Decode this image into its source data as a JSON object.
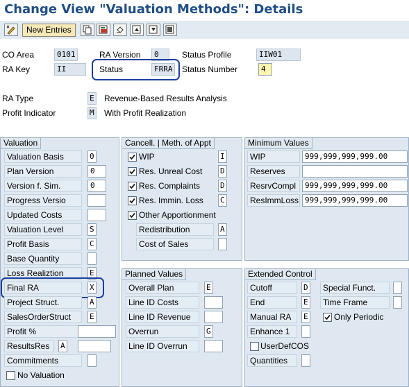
{
  "title": "Change View \"Valuation Methods\": Details",
  "toolbar": {
    "new_entries": "New Entries",
    "icons": [
      "display-change-icon",
      "copy-icon",
      "delete-icon",
      "undo-icon",
      "previous-entry-icon",
      "next-entry-icon",
      "select-all-icon"
    ]
  },
  "header": {
    "co_area_label": "CO Area",
    "co_area_value": "0101",
    "ra_version_label": "RA Version",
    "ra_version_value": "0",
    "status_profile_label": "Status Profile",
    "status_profile_value": "IIW01",
    "ra_key_label": "RA Key",
    "ra_key_value": "II",
    "status_label": "Status",
    "status_value": "FRRA",
    "status_number_label": "Status Number",
    "status_number_value": "4",
    "ra_type_label": "RA Type",
    "ra_type_value": "E",
    "ra_type_desc": "Revenue-Based Results Analysis",
    "profit_indicator_label": "Profit Indicator",
    "profit_indicator_value": "M",
    "profit_indicator_desc": "With Profit Realization"
  },
  "valuation": {
    "title": "Valuation",
    "rows": [
      {
        "label": "Valuation Basis",
        "value": "0"
      },
      {
        "label": "Plan Version",
        "value": "0"
      },
      {
        "label": "Version f. Sim.",
        "value": "0"
      },
      {
        "label": "Progress Versio",
        "value": ""
      },
      {
        "label": "Updated Costs",
        "value": ""
      },
      {
        "label": "Valuation Level",
        "value": "S"
      },
      {
        "label": "Profit Basis",
        "value": "C"
      },
      {
        "label": "Base Quantity",
        "value": ""
      },
      {
        "label": "Loss Realiztion",
        "value": "E"
      },
      {
        "label": "Final RA",
        "value": "X"
      },
      {
        "label": "Project Struct.",
        "value": "A"
      },
      {
        "label": "SalesOrderStruct",
        "value": "E"
      },
      {
        "label": "Profit %",
        "value": ""
      },
      {
        "label": "ResultsRes",
        "value": "A",
        "value2": ""
      },
      {
        "label": "Commitments",
        "value": ""
      }
    ],
    "no_valuation": "No Valuation"
  },
  "cancellation": {
    "title": "Cancell. | Meth. of Appt",
    "rows": [
      {
        "label": "WIP",
        "value": "I",
        "checked": true
      },
      {
        "label": "Res. Unreal Cost",
        "value": "D",
        "checked": true
      },
      {
        "label": "Res. Complaints",
        "value": "D",
        "checked": true
      },
      {
        "label": "Res. Immin. Loss",
        "value": "C",
        "checked": true
      }
    ],
    "other_apportionment": "Other Apportionment",
    "redistribution_label": "Redistribution",
    "redistribution_value": "A",
    "cost_of_sales_label": "Cost of Sales",
    "cost_of_sales_value": ""
  },
  "minimum": {
    "title": "Minimum Values",
    "rows": [
      {
        "label": "WIP",
        "value": "999,999,999,999.00"
      },
      {
        "label": "Reserves",
        "value": ""
      },
      {
        "label": "ResrvCompl",
        "value": "999,999,999,999.00"
      },
      {
        "label": "ResImmLoss",
        "value": "999,999,999,999.00"
      }
    ]
  },
  "planned": {
    "title": "Planned Values",
    "rows": [
      {
        "label": "Overall Plan",
        "value": "E"
      },
      {
        "label": "Line ID Costs",
        "value": ""
      },
      {
        "label": "Line ID Revenue",
        "value": ""
      },
      {
        "label": "Overrun",
        "value": "G"
      },
      {
        "label": "Line ID Overrun",
        "value": ""
      }
    ]
  },
  "extended": {
    "title": "Extended Control",
    "rows": [
      {
        "label": "Cutoff",
        "value": "D"
      },
      {
        "label": "End",
        "value": "E"
      },
      {
        "label": "Manual RA",
        "value": "E"
      },
      {
        "label": "Enhance 1",
        "value": ""
      }
    ],
    "user_def_cos": "UserDefCOS",
    "quantities_label": "Quantities",
    "quantities_value": "",
    "special_funct_label": "Special Funct.",
    "special_funct_value": "",
    "time_frame_label": "Time Frame",
    "time_frame_value": "",
    "only_periodic": "Only Periodic"
  }
}
